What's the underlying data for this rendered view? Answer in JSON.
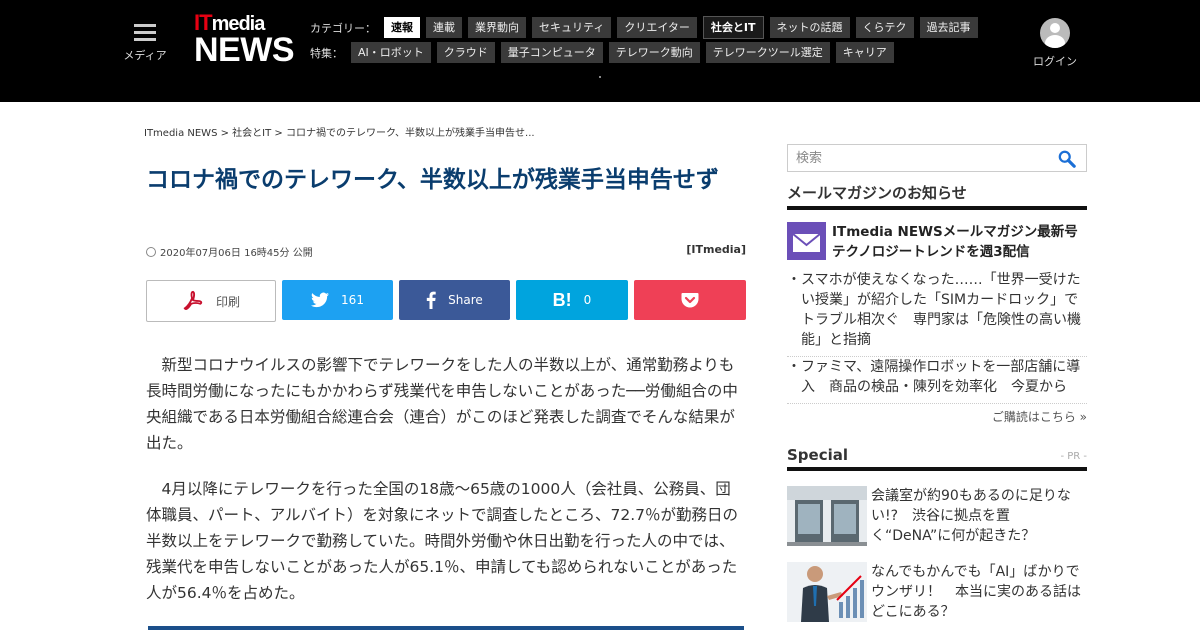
{
  "header": {
    "menu_label": "メディア",
    "logo_it_i": "IT",
    "logo_it_m": "media",
    "logo_news": "NEWS",
    "category_label": "カテゴリー：",
    "categories": [
      {
        "label": "速報",
        "state": "active"
      },
      {
        "label": "連載",
        "state": ""
      },
      {
        "label": "業界動向",
        "state": ""
      },
      {
        "label": "セキュリティ",
        "state": ""
      },
      {
        "label": "クリエイター",
        "state": ""
      },
      {
        "label": "社会とIT",
        "state": "current"
      },
      {
        "label": "ネットの話題",
        "state": ""
      },
      {
        "label": "くらテク",
        "state": ""
      },
      {
        "label": "過去記事",
        "state": ""
      }
    ],
    "feature_label": "特集：",
    "features": [
      "AI・ロボット",
      "クラウド",
      "量子コンピュータ",
      "テレワーク動向",
      "テレワークツール選定",
      "キャリア"
    ],
    "login_label": "ログイン"
  },
  "breadcrumb": "ITmedia NEWS > 社会とIT > コロナ禍でのテレワーク、半数以上が残業手当申告せ...",
  "article": {
    "title": "コロナ禍でのテレワーク、半数以上が残業手当申告せず",
    "published": "2020年07月06日 16時45分 公開",
    "source": "[ITmedia]",
    "paragraphs": [
      "新型コロナウイルスの影響下でテレワークをした人の半数以上が、通常勤務よりも長時間労働になったにもかかわらず残業代を申告しないことがあった──労働組合の中央組織である日本労働組合総連合会（連合）がこのほど発表した調査でそんな結果が出た。",
      "4月以降にテレワークを行った全国の18歳～65歳の1000人（会社員、公務員、団体職員、パート、アルバイト）を対象にネットで調査したところ、72.7％が勤務日の半数以上をテレワークで勤務していた。時間外労働や休日出勤を行った人の中では、残業代を申告しないことがあった人が65.1％、申請しても認められないことがあった人が56.4％を占めた。"
    ]
  },
  "share": {
    "print_label": "印刷",
    "twitter_count": "161",
    "facebook_label": "Share",
    "hatena_count": "0"
  },
  "sidebar": {
    "search_placeholder": "検索",
    "mailmag_heading": "メールマガジンのお知らせ",
    "mailmag_feature": "ITmedia NEWSメールマガジン最新号 テクノロジートレンドを週3配信",
    "mailmag_items": [
      "スマホが使えなくなった……「世界一受けたい授業」が紹介した「SIMカードロック」でトラブル相次ぐ　専門家は「危険性の高い機能」と指摘",
      "ファミマ、遠隔操作ロボットを一部店舗に導入　商品の検品・陳列を効率化　今夏から"
    ],
    "mailmag_more": "ご購読はこちら »",
    "special_heading": "Special",
    "special_pr": "- PR -",
    "special_items": [
      "会議室が約90もあるのに足りない!?　渋谷に拠点を置く“DeNA”に何が起きた？",
      "なんでもかんでも「AI」ばかりでウンザリ！　本当に実のある話はどこにある？"
    ]
  },
  "colors": {
    "title": "#0a3d6e",
    "twitter": "#1da1f2",
    "facebook": "#3b5998",
    "hatena": "#00a4de",
    "pocket": "#ef4056",
    "logo_red": "#e60012"
  }
}
